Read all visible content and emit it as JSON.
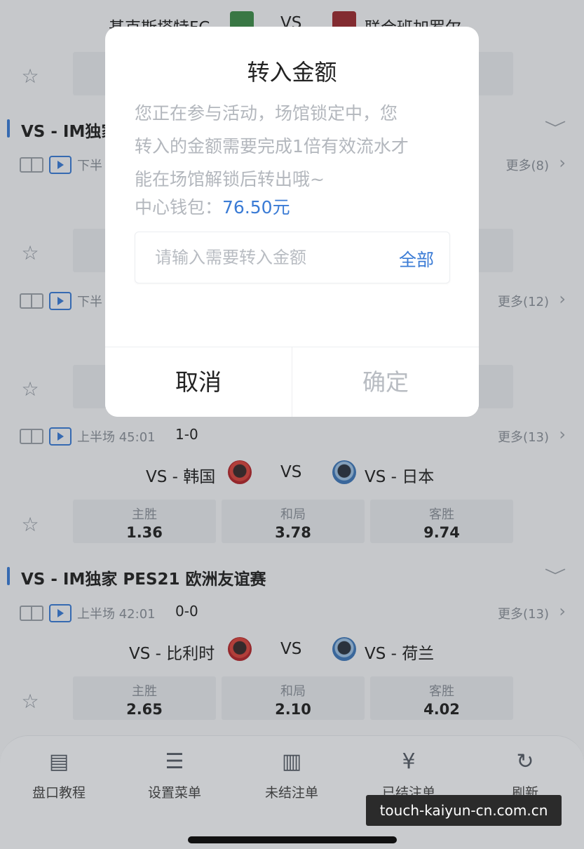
{
  "top_match": {
    "home": "基克斯塔特FC",
    "vs": "VS",
    "away": "联合班加罗尔"
  },
  "league1": {
    "name": "VS - IM独家"
  },
  "match1": {
    "time": "下半",
    "more": "更多(8)"
  },
  "match2": {
    "time": "下半",
    "more": "更多(12)"
  },
  "match3": {
    "time": "上半场 45:01",
    "score": "1-0",
    "more": "更多(13)",
    "home": "VS - 韩国",
    "vs": "VS",
    "away": "VS - 日本",
    "odds": [
      {
        "label": "主胜",
        "value": "1.36"
      },
      {
        "label": "和局",
        "value": "3.78"
      },
      {
        "label": "客胜",
        "value": "9.74"
      }
    ]
  },
  "league2": {
    "name": "VS - IM独家 PES21 欧洲友谊赛"
  },
  "match4": {
    "time": "上半场 42:01",
    "score": "0-0",
    "more": "更多(13)",
    "home": "VS - 比利时",
    "vs": "VS",
    "away": "VS - 荷兰",
    "odds": [
      {
        "label": "主胜",
        "value": "2.65"
      },
      {
        "label": "和局",
        "value": "2.10"
      },
      {
        "label": "客胜",
        "value": "4.02"
      }
    ]
  },
  "bottom_nav": [
    {
      "label": "盘口教程",
      "icon": "document-icon"
    },
    {
      "label": "设置菜单",
      "icon": "sliders-icon"
    },
    {
      "label": "未结注单",
      "icon": "clipboard-icon"
    },
    {
      "label": "已结注单",
      "icon": "receipt-icon"
    },
    {
      "label": "刷新",
      "icon": "refresh-icon"
    }
  ],
  "watermark": "touch-kaiyun-cn.com.cn",
  "dialog": {
    "title": "转入金额",
    "notice_line1": "您正在参与活动，场馆锁定中，您",
    "notice_line2": "转入的金额需要完成1倍有效流水才",
    "notice_line3": "能在场馆解锁后转出哦~",
    "wallet_label": "中心钱包：",
    "wallet_amount": "76.50元",
    "input_placeholder": "请输入需要转入金额",
    "all_label": "全部",
    "cancel_label": "取消",
    "confirm_label": "确定"
  },
  "colors": {
    "accent": "#3a7bd5",
    "muted": "#b3b7bd"
  }
}
